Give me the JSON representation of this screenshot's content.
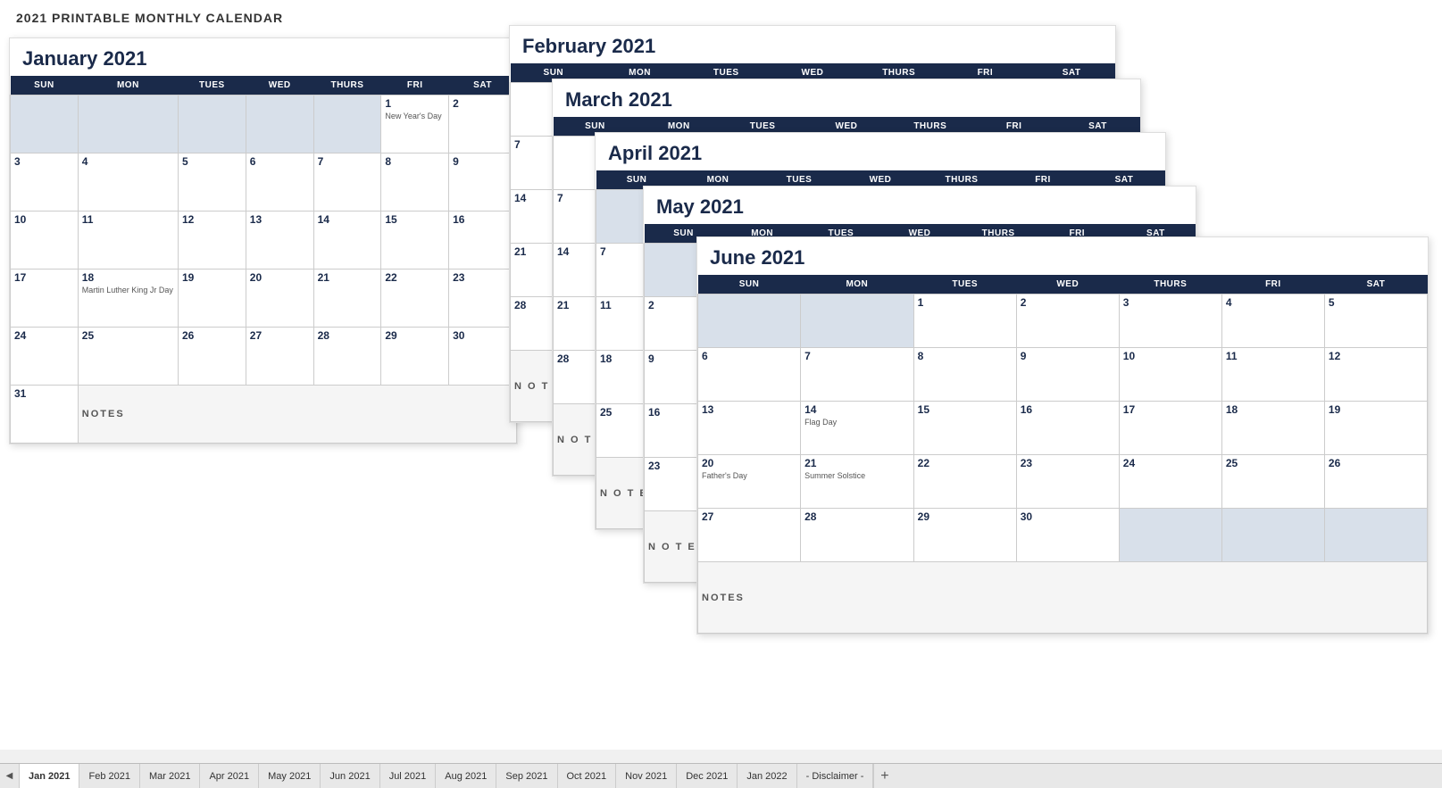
{
  "title": "2021 PRINTABLE MONTHLY CALENDAR",
  "january": {
    "label": "January 2021",
    "headers": [
      "SUN",
      "MON",
      "TUES",
      "WED",
      "THURS",
      "FRI",
      "SAT"
    ],
    "rows": [
      [
        {
          "d": "",
          "shade": true
        },
        {
          "d": "",
          "shade": true
        },
        {
          "d": "",
          "shade": true
        },
        {
          "d": "",
          "shade": true
        },
        {
          "d": "",
          "shade": true
        },
        {
          "d": "1",
          "holiday": "New Year's Day"
        },
        {
          "d": "2"
        }
      ],
      [
        {
          "d": "3"
        },
        {
          "d": "4"
        },
        {
          "d": "5"
        },
        {
          "d": "6"
        },
        {
          "d": "7"
        },
        {
          "d": "8"
        },
        {
          "d": "9"
        }
      ],
      [
        {
          "d": "10"
        },
        {
          "d": "11"
        },
        {
          "d": "12"
        },
        {
          "d": "13"
        },
        {
          "d": "14"
        },
        {
          "d": "15"
        },
        {
          "d": "16"
        }
      ],
      [
        {
          "d": "17"
        },
        {
          "d": "18",
          "holiday": "Martin Luther King Jr Day"
        },
        {
          "d": "19"
        },
        {
          "d": "20"
        },
        {
          "d": "21"
        },
        {
          "d": "22"
        },
        {
          "d": "23"
        }
      ],
      [
        {
          "d": "24"
        },
        {
          "d": "25"
        },
        {
          "d": "26"
        },
        {
          "d": "27"
        },
        {
          "d": "28"
        },
        {
          "d": "29"
        },
        {
          "d": "30"
        }
      ],
      [
        {
          "d": "31"
        },
        {
          "notes": true
        }
      ]
    ],
    "notes_label": "NOTES"
  },
  "february": {
    "label": "February 2021",
    "headers": [
      "SUN",
      "MON",
      "TUES",
      "WED",
      "THURS",
      "FRI",
      "SAT"
    ]
  },
  "march": {
    "label": "March 2021",
    "headers": [
      "SUN",
      "MON",
      "TUES",
      "WED",
      "THURS",
      "FRI",
      "SAT"
    ]
  },
  "april": {
    "label": "April 2021",
    "headers": [
      "SUN",
      "MON",
      "TUES",
      "WED",
      "THURS",
      "FRI",
      "SAT"
    ]
  },
  "may": {
    "label": "May 2021",
    "headers": [
      "SUN",
      "MON",
      "TUES",
      "WED",
      "THURS",
      "FRI",
      "SAT"
    ]
  },
  "june": {
    "label": "June 2021",
    "headers": [
      "SUN",
      "MON",
      "TUES",
      "WED",
      "THURS",
      "FRI",
      "SAT"
    ],
    "rows": [
      [
        {
          "d": "",
          "shade": true
        },
        {
          "d": "",
          "shade": true
        },
        {
          "d": "1"
        },
        {
          "d": "2"
        },
        {
          "d": "3"
        },
        {
          "d": "4"
        },
        {
          "d": "5"
        }
      ],
      [
        {
          "d": "6"
        },
        {
          "d": "7"
        },
        {
          "d": "8"
        },
        {
          "d": "9"
        },
        {
          "d": "10"
        },
        {
          "d": "11"
        },
        {
          "d": "12"
        }
      ],
      [
        {
          "d": "13"
        },
        {
          "d": "14"
        },
        {
          "d": "15"
        },
        {
          "d": "16"
        },
        {
          "d": "17"
        },
        {
          "d": "18"
        },
        {
          "d": "19"
        }
      ],
      [
        {
          "d": "20"
        },
        {
          "d": "21"
        },
        {
          "d": "22"
        },
        {
          "d": "23"
        },
        {
          "d": "24"
        },
        {
          "d": "25"
        },
        {
          "d": "26"
        }
      ],
      [
        {
          "d": "27"
        },
        {
          "d": "28"
        },
        {
          "d": "29"
        },
        {
          "d": "30"
        },
        {
          "d": "",
          "shade": true
        },
        {
          "d": "",
          "shade": true
        },
        {
          "d": "",
          "shade": true
        }
      ],
      [
        {
          "notes": true
        }
      ]
    ],
    "holidays": {
      "1": "",
      "14": "Flag Day",
      "20": "Father's Day",
      "21": "Summer Solstice"
    },
    "notes_label": "NOTES"
  },
  "tabs": [
    {
      "label": "Jan 2021",
      "active": true
    },
    {
      "label": "Feb 2021"
    },
    {
      "label": "Mar 2021"
    },
    {
      "label": "Apr 2021"
    },
    {
      "label": "May 2021"
    },
    {
      "label": "Jun 2021"
    },
    {
      "label": "Jul 2021"
    },
    {
      "label": "Aug 2021"
    },
    {
      "label": "Sep 2021"
    },
    {
      "label": "Oct 2021"
    },
    {
      "label": "Nov 2021"
    },
    {
      "label": "Dec 2021"
    },
    {
      "label": "Jan 2022"
    },
    {
      "label": "- Disclaimer -"
    }
  ],
  "tab_arrow": "◀",
  "tab_add": "+"
}
